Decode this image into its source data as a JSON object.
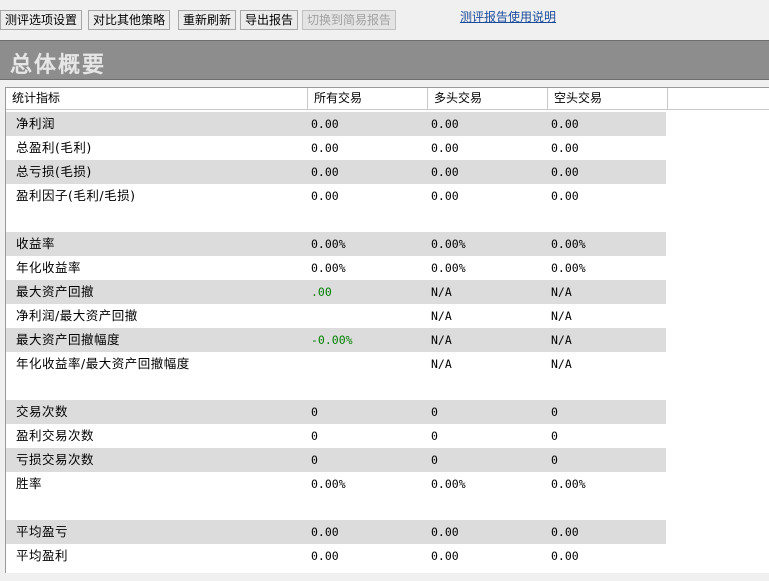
{
  "toolbar": {
    "buttons": [
      {
        "label": "测评选项设置",
        "disabled": false
      },
      {
        "label": "对比其他策略",
        "disabled": false
      },
      {
        "label": "重新刷新",
        "disabled": false
      },
      {
        "label": "导出报告",
        "disabled": false
      },
      {
        "label": "切换到简易报告",
        "disabled": true
      }
    ],
    "help_link": "测评报告使用说明"
  },
  "title": "总体概要",
  "table": {
    "columns": [
      "统计指标",
      "所有交易",
      "多头交易",
      "空头交易"
    ],
    "rows": [
      {
        "label": "净利润",
        "all": "0.00",
        "long": "0.00",
        "short": "0.00",
        "shaded": true
      },
      {
        "label": "总盈利(毛利)",
        "all": "0.00",
        "long": "0.00",
        "short": "0.00",
        "shaded": false
      },
      {
        "label": "总亏损(毛损)",
        "all": "0.00",
        "long": "0.00",
        "short": "0.00",
        "shaded": true
      },
      {
        "label": "盈利因子(毛利/毛损)",
        "all": "0.00",
        "long": "0.00",
        "short": "0.00",
        "shaded": false
      },
      {
        "spacer": true
      },
      {
        "label": "收益率",
        "all": "0.00%",
        "long": "0.00%",
        "short": "0.00%",
        "shaded": true
      },
      {
        "label": "年化收益率",
        "all": "0.00%",
        "long": "0.00%",
        "short": "0.00%",
        "shaded": false
      },
      {
        "label": "最大资产回撤",
        "all": ".00",
        "long": "N/A",
        "short": "N/A",
        "shaded": true,
        "all_green": true
      },
      {
        "label": "净利润/最大资产回撤",
        "all": "",
        "long": "N/A",
        "short": "N/A",
        "shaded": false
      },
      {
        "label": "最大资产回撤幅度",
        "all": "-0.00%",
        "long": "N/A",
        "short": "N/A",
        "shaded": true,
        "all_green": true
      },
      {
        "label": "年化收益率/最大资产回撤幅度",
        "all": "",
        "long": "N/A",
        "short": "N/A",
        "shaded": false
      },
      {
        "spacer": true
      },
      {
        "label": "交易次数",
        "all": "0",
        "long": "0",
        "short": "0",
        "shaded": true
      },
      {
        "label": "盈利交易次数",
        "all": "0",
        "long": "0",
        "short": "0",
        "shaded": false
      },
      {
        "label": "亏损交易次数",
        "all": "0",
        "long": "0",
        "short": "0",
        "shaded": true
      },
      {
        "label": "胜率",
        "all": "0.00%",
        "long": "0.00%",
        "short": "0.00%",
        "shaded": false
      },
      {
        "spacer": true
      },
      {
        "label": "平均盈亏",
        "all": "0.00",
        "long": "0.00",
        "short": "0.00",
        "shaded": true
      },
      {
        "label": "平均盈利",
        "all": "0.00",
        "long": "0.00",
        "short": "0.00",
        "shaded": false
      }
    ]
  },
  "colors": {
    "title_bar": "#8d8d8d",
    "row_shade": "#dcdcdc",
    "value_green": "#008000",
    "link": "#1a4a9a"
  }
}
